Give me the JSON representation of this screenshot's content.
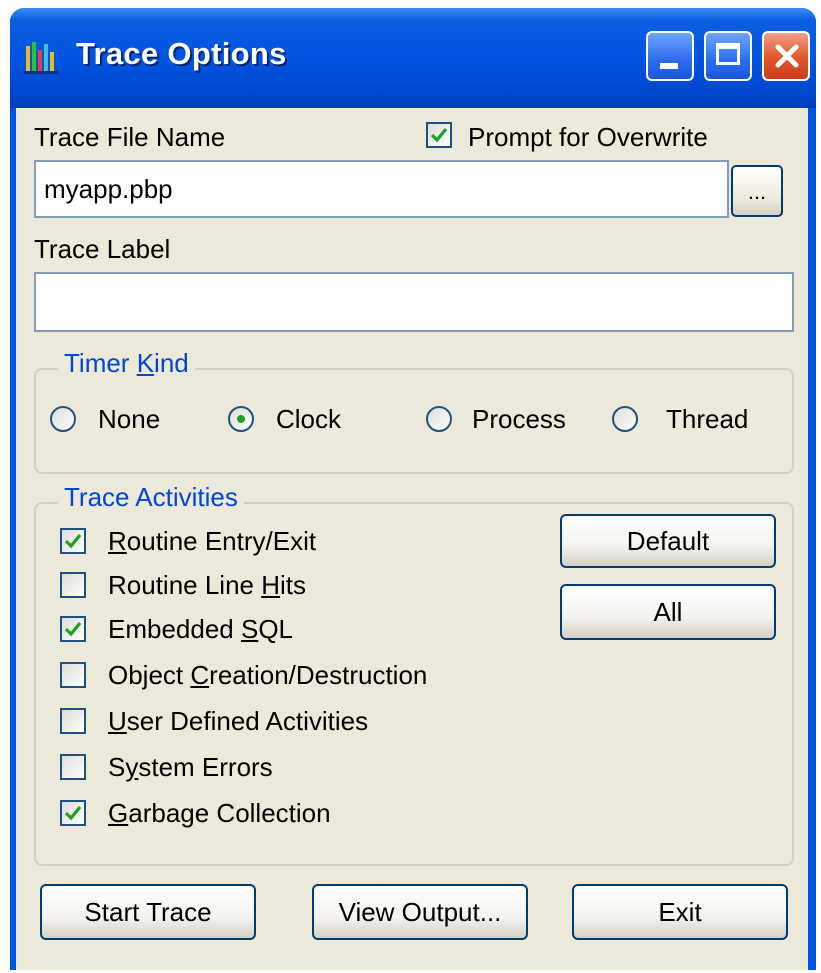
{
  "window": {
    "title": "Trace Options",
    "icon": "bar-chart-icon"
  },
  "title_buttons": {
    "minimize": "minimize-icon",
    "maximize": "maximize-icon",
    "close": "close-icon"
  },
  "file": {
    "label": "Trace File Name",
    "value": "myapp.pbp",
    "browse_label": "..."
  },
  "prompt_overwrite": {
    "label": "Prompt for Overwrite",
    "checked": true
  },
  "trace_label": {
    "label": "Trace Label",
    "value": ""
  },
  "timer_kind": {
    "legend_pre": "Timer ",
    "legend_mnemonic": "K",
    "legend_post": "ind",
    "options": [
      {
        "label": "None",
        "selected": false
      },
      {
        "label": "Clock",
        "selected": true
      },
      {
        "label": "Process",
        "selected": false
      },
      {
        "label": "Thread",
        "selected": false
      }
    ]
  },
  "activities": {
    "legend": "Trace Activities",
    "items": [
      {
        "pre": "",
        "mn": "R",
        "post": "outine Entry/Exit",
        "checked": true
      },
      {
        "pre": "Routine Line ",
        "mn": "H",
        "post": "its",
        "checked": false
      },
      {
        "pre": "Embedded ",
        "mn": "S",
        "post": "QL",
        "checked": true
      },
      {
        "pre": "Object ",
        "mn": "C",
        "post": "reation/Destruction",
        "checked": false
      },
      {
        "pre": "",
        "mn": "U",
        "post": "ser Defined Activities",
        "checked": false
      },
      {
        "pre": "S",
        "mn": "y",
        "post": "stem Errors",
        "checked": false
      },
      {
        "pre": "",
        "mn": "G",
        "post": "arbage Collection",
        "checked": true
      }
    ],
    "default_button": "Default",
    "all_button": "All"
  },
  "footer": {
    "start": "Start Trace",
    "view": "View Output...",
    "exit": "Exit"
  },
  "colors": {
    "titlebar": "#0054e3",
    "face": "#ece9d8",
    "group_text": "#0046d5",
    "check": "#21a121",
    "close": "#e0542a"
  }
}
